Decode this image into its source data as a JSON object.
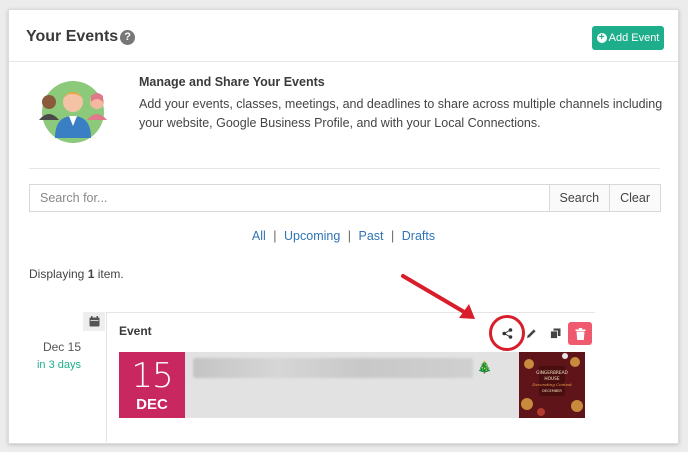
{
  "header": {
    "title": "Your Events",
    "help_icon": "question-circle-icon",
    "add_button_label": "Add Event",
    "add_icon": "plus-circle-icon"
  },
  "intro": {
    "illustration": "users-group-icon",
    "title": "Manage and Share Your Events",
    "text": "Add your events, classes, meetings, and deadlines to share across multiple channels including your website, Google Business Profile, and with your Local Connections."
  },
  "search": {
    "placeholder": "Search for...",
    "search_label": "Search",
    "clear_label": "Clear"
  },
  "filters": {
    "all": "All",
    "upcoming": "Upcoming",
    "past": "Past",
    "drafts": "Drafts",
    "separator": "|"
  },
  "displaying": {
    "prefix": "Displaying",
    "count": "1",
    "suffix": "item."
  },
  "event": {
    "date_label": "Dec 15",
    "relative_label": "in 3 days",
    "card_title": "Event",
    "date_day": "15",
    "date_month": "DEC",
    "actions": [
      "share-icon",
      "edit-icon",
      "copy-icon",
      "trash-icon"
    ],
    "thumbnail_lines": [
      "GINGERBREAD",
      "HOUSE",
      "Decorating Contest",
      "DECEMBER"
    ]
  },
  "colors": {
    "accent": "#1fae8b",
    "link": "#2f74b5",
    "date_block": "#c8275f",
    "delete": "#ef5a6f",
    "annotation": "#d81e2a"
  }
}
